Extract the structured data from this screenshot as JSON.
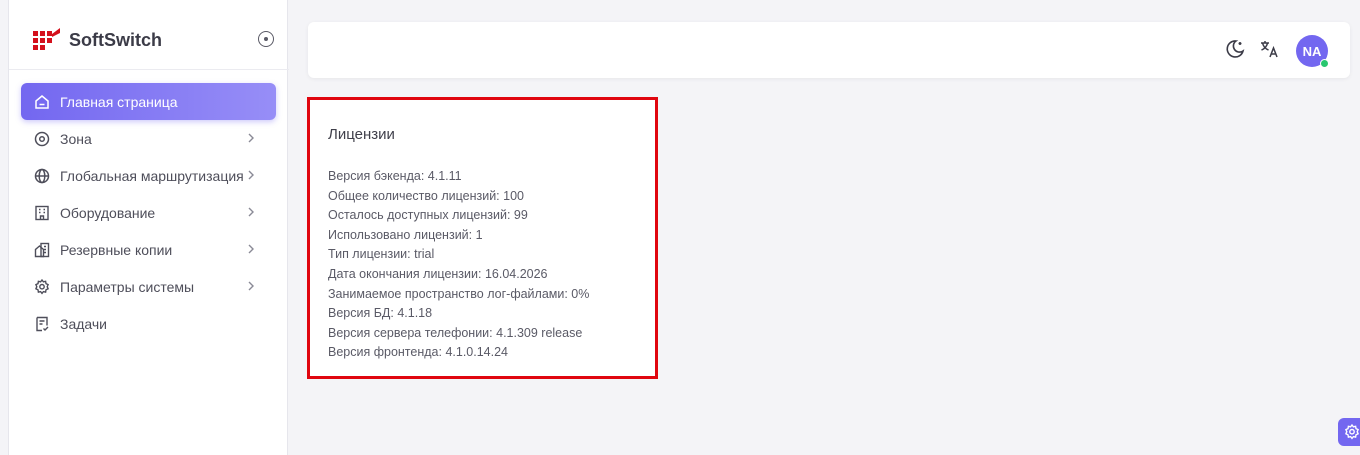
{
  "brand": {
    "name": "SoftSwitch"
  },
  "sidebar": {
    "items": [
      {
        "label": "Главная страница",
        "icon": "home-icon",
        "active": true,
        "has_children": false
      },
      {
        "label": "Зона",
        "icon": "location-pin-icon",
        "active": false,
        "has_children": true
      },
      {
        "label": "Глобальная маршрутизация",
        "icon": "globe-icon",
        "active": false,
        "has_children": true
      },
      {
        "label": "Оборудование",
        "icon": "building-icon",
        "active": false,
        "has_children": true
      },
      {
        "label": "Резервные копии",
        "icon": "backup-icon",
        "active": false,
        "has_children": true
      },
      {
        "label": "Параметры системы",
        "icon": "gear-icon",
        "active": false,
        "has_children": true
      },
      {
        "label": "Задачи",
        "icon": "task-list-icon",
        "active": false,
        "has_children": false
      }
    ]
  },
  "topbar": {
    "theme_icon": "moon-icon",
    "language_icon": "translate-icon",
    "avatar_initials": "NA",
    "avatar_status": "online"
  },
  "license_card": {
    "title": "Лицензии",
    "lines": [
      "Версия бэкенда: 4.1.11",
      "Общее количество лицензий: 100",
      "Осталось доступных лицензий: 99",
      "Использовано лицензий: 1",
      "Тип лицензии: trial",
      "Дата окончания лицензии: 16.04.2026",
      "Занимаемое пространство лог-файлами: 0%",
      "Версия БД: 4.1.18",
      "Версия сервера телефонии: 4.1.309 release",
      "Версия фронтенда: 4.1.0.14.24"
    ]
  },
  "colors": {
    "accent": "#7367f0",
    "highlight_border": "#e0060f",
    "online": "#28c76f"
  }
}
